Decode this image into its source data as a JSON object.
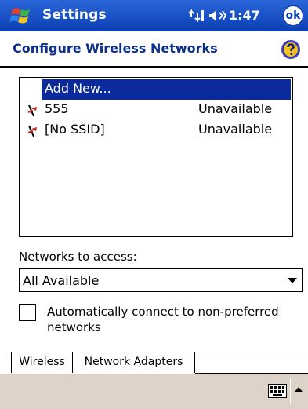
{
  "titlebar": {
    "app_title": "Settings",
    "time": "1:47",
    "ok_label": "ok"
  },
  "header": {
    "title": "Configure Wireless Networks"
  },
  "networks": [
    {
      "name": "Add New...",
      "status": ""
    },
    {
      "name": "555",
      "status": "Unavailable"
    },
    {
      "name": "[No SSID]",
      "status": "Unavailable"
    }
  ],
  "access": {
    "label": "Networks to access:",
    "selected": "All Available"
  },
  "auto_connect": {
    "label": "Automatically connect to non-preferred networks",
    "checked": false
  },
  "tabs": [
    {
      "label": "Wireless"
    },
    {
      "label": "Network Adapters"
    }
  ],
  "colors": {
    "titlebar": "#0b3fb3",
    "selection": "#0a2a9e",
    "title_text": "#0b2f8a",
    "menubar": "#ddd3c8"
  }
}
